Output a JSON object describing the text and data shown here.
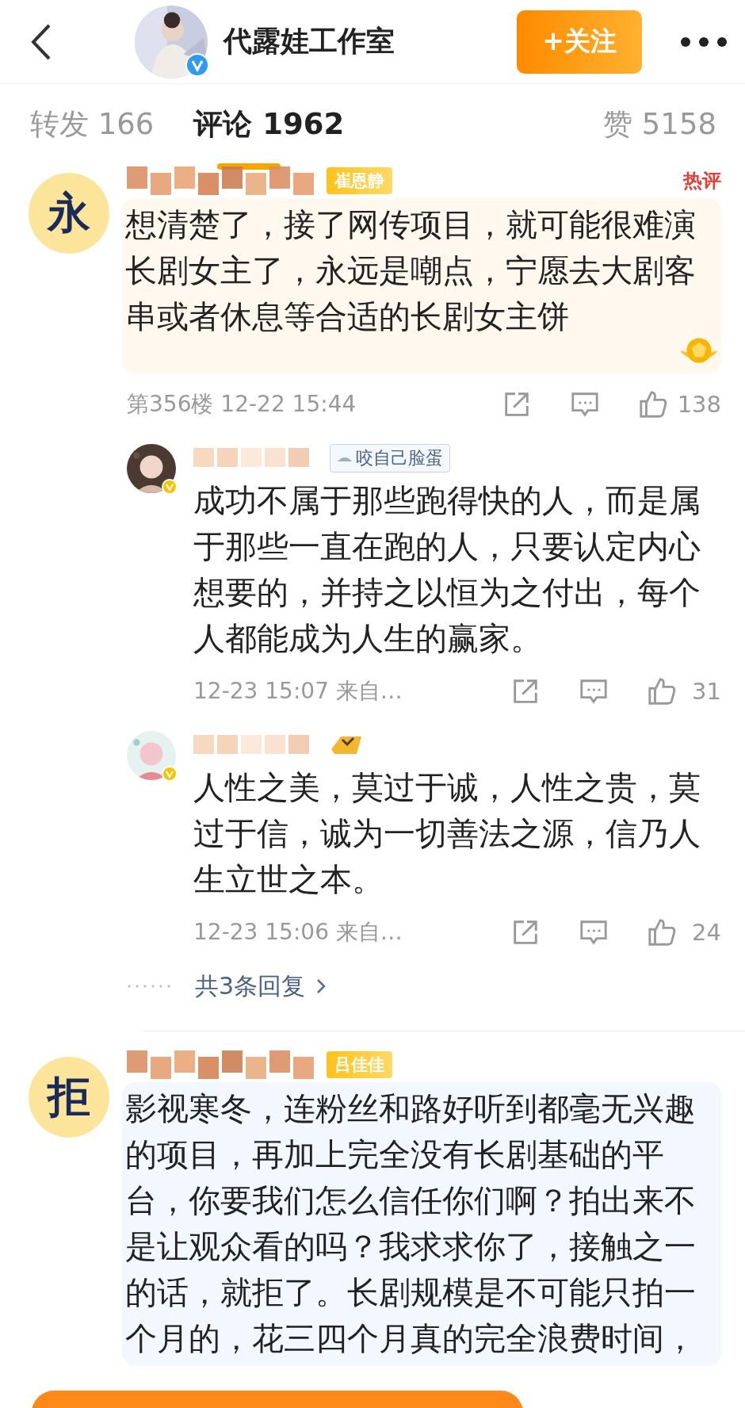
{
  "header": {
    "title": "代露娃工作室",
    "verified": true,
    "follow_button": "+关注"
  },
  "tabs": [
    {
      "label": "转发 166",
      "selected": false
    },
    {
      "label": "评论 1962",
      "selected": true
    },
    {
      "label": "赞 5158",
      "selected": false
    }
  ],
  "comments": [
    {
      "avatar_text": "永",
      "tag": "崔恩静",
      "hot_label": "热评",
      "medal": true,
      "text": "想清楚了，接了网传项目，就可能很难演长剧女主了，永远是嘲点，宁愿去大剧客串或者休息等合适的长剧女主饼",
      "meta": "第356楼 12-22 15:44",
      "likes": "138",
      "replies": [
        {
          "tag": "咬自己脸蛋",
          "verified": true,
          "text": "成功不属于那些跑得快的人，而是属于那些一直在跑的人，只要认定内心想要的，并持之以恒为之付出，每个人都能成为人生的赢家。",
          "meta": "12-23 15:07 来自…",
          "likes": "31"
        },
        {
          "badge": true,
          "verified": true,
          "text": "人性之美，莫过于诚，人性之贵，莫过于信，诚为一切善法之源，信乃人生立世之本。",
          "meta": "12-23 15:06 来自…",
          "likes": "24"
        }
      ],
      "more_replies": "共3条回复"
    },
    {
      "avatar_text": "拒",
      "tag": "吕佳佳",
      "text": "影视寒冬，连粉丝和路好听到都毫无兴趣的项目，再加上完全没有长剧基础的平台，你要我们怎么信任你们啊？拍出来不是让观众看的吗？我求求你了，接触之一的话，就拒了。长剧规模是不可能只拍一个月的，花三四个月真的完全浪费时间，"
    }
  ]
}
